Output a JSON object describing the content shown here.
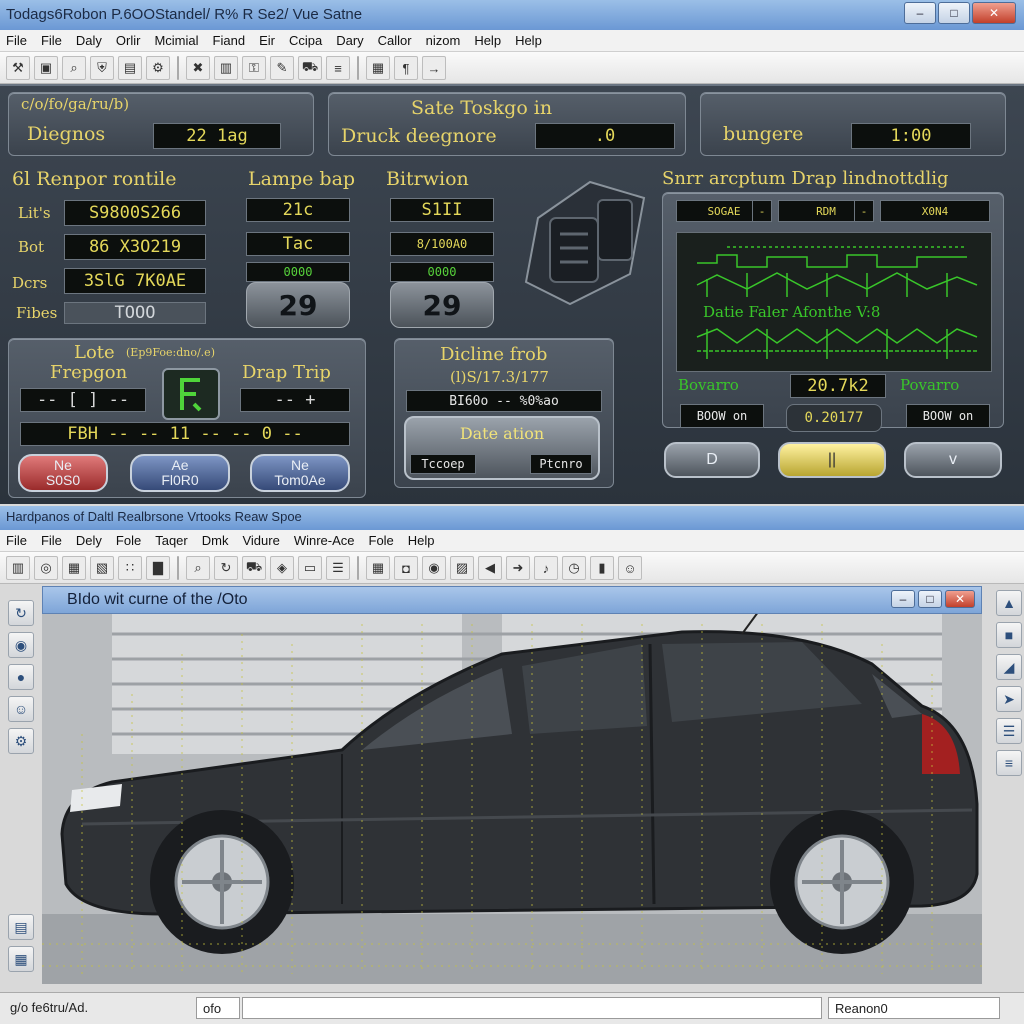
{
  "main_window": {
    "title": "Todags6Robon P.6OOStandel/ R% R Se2/ Vue Satne",
    "menu": [
      "File",
      "File",
      "Daly",
      "Orlir",
      "Mcimial",
      "Fiand",
      "Eir",
      "Ccipa",
      "Dary",
      "Callor",
      "nizom",
      "Help",
      "Help"
    ]
  },
  "top_status": {
    "left_title": "c/o/fo/ga/ru/b)",
    "left_label": "Diegnos",
    "left_value": "22  1ag",
    "mid_title": "Sate Toskgo in",
    "mid_label": "Druck deegnore",
    "mid_value": ".0",
    "right_label": "bungere",
    "right_value": "1:00"
  },
  "sensor": {
    "title": "6l  Renpor  rontile",
    "rows": [
      {
        "label": "Lit's",
        "value": "S9800S266"
      },
      {
        "label": "Bot",
        "value": "86  X3O219"
      },
      {
        "label": "Dcrs",
        "value": "3SlG 7K0AE"
      },
      {
        "label": "Fibes",
        "value": "TOOO"
      }
    ]
  },
  "lamp": {
    "title": "Lampe bap",
    "readouts": [
      "21c",
      "Tac",
      "0000"
    ],
    "gauge": "29"
  },
  "filtration": {
    "title": "Bitrwion",
    "readouts": [
      "S1II",
      "8/100A0",
      "0000"
    ],
    "gauge": "29"
  },
  "scope": {
    "title": "Snrr arcptum  Drap  lindnottdlig",
    "tabs": [
      "SOGAE",
      "-",
      "RDM",
      "-",
      "X0N4",
      "-"
    ],
    "caption": "Datie  Faler  Afonthe  V:8",
    "value_left": "Bovarro",
    "value_mid": "20.7k2",
    "value_right": "Povarro",
    "button_left": "BOOW  on",
    "button_mid": "0.20177",
    "button_right": "BOOW  on",
    "colors": {
      "trace": "#39c62a",
      "screen": "#1a201d"
    }
  },
  "lote": {
    "title": "Lote",
    "subtitle": "(Ep9Foe:dno/.e)",
    "label": "Frepgon",
    "drap_label": "Drap  Trip",
    "readout_left": "-- [  ] --",
    "readout_right": "--  +",
    "bottom_readout": "FBH  --  -- 11  --  --  0  --",
    "buttons": [
      {
        "top": "Ne",
        "bottom": "S0S0"
      },
      {
        "top": "Ae",
        "bottom": "Fl0R0"
      },
      {
        "top": "Ne",
        "bottom": "Tom0Ae"
      }
    ]
  },
  "decline": {
    "title": "Dicline frob",
    "subtitle": "(l)S/17.3/177",
    "readout": "BI60o  --  %0%ao",
    "date_label": "Date  ation",
    "btn_left": "Tccoep",
    "btn_right": "Ptcnro"
  },
  "scope_controls": {
    "play": "D",
    "pause": "||",
    "down": "v"
  },
  "viewer_window": {
    "title": "Hardpanos of Daltl Realbrsone Vrtooks Reaw Spoe",
    "menu": [
      "File",
      "File",
      "Dely",
      "Fole",
      "Taqer",
      "Dmk",
      "Vidure",
      "Winre-Ace",
      "Fole",
      "Help"
    ],
    "child_title": "BIdo wit curne of the /Oto",
    "status_left": "g/o fe6tru/Ad.",
    "status_mid": "ofo",
    "status_right": "Reanon0"
  },
  "icons": {
    "toolbar_top": [
      "wrench-icon",
      "camera-icon",
      "search-icon",
      "shield-icon",
      "card-icon",
      "tool-icon",
      "close-x-icon",
      "folder-icon",
      "key-icon",
      "edit-icon",
      "car-icon",
      "graph-icon",
      "chip-icon",
      "text-icon",
      "nav-icon"
    ],
    "toolbar_bottom": [
      "folder-icon",
      "globe-icon",
      "grid-icon",
      "disk-icon",
      "dots-icon",
      "chart-icon",
      "search-icon",
      "refresh-icon",
      "car-icon",
      "tag-icon",
      "screen-icon",
      "layers-icon",
      "chip-icon",
      "cart-icon",
      "pin-icon",
      "book-icon",
      "speaker-icon",
      "arrow-icon",
      "note-icon",
      "clock-icon",
      "battery-icon",
      "user-icon"
    ]
  }
}
